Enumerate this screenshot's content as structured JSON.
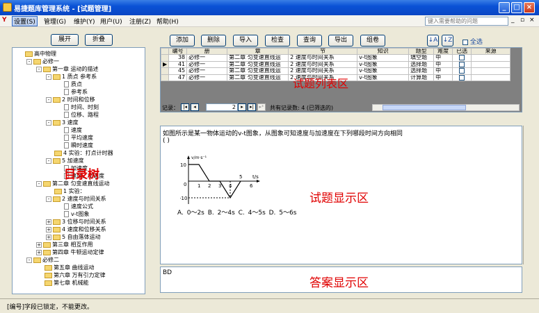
{
  "window": {
    "title": "易捷题库管理系统 - [试题管理]"
  },
  "menu": {
    "items": [
      "设置(S)",
      "管理(G)",
      "维护(Y)",
      "用户(U)",
      "注册(Z)",
      "帮助(H)"
    ],
    "help_placeholder": "键入需要帮助的问题"
  },
  "left": {
    "expand_label": "展开",
    "collapse_label": "折叠",
    "overlay": "目录树",
    "tree": [
      {
        "label": "高中物理",
        "level": 0,
        "kind": "folder"
      },
      {
        "label": "必修一",
        "level": 1,
        "kind": "folder",
        "toggle": "-"
      },
      {
        "label": "第一章 运动的描述",
        "level": 2,
        "kind": "folder",
        "toggle": "-"
      },
      {
        "label": "1 质点 参考系",
        "level": 3,
        "kind": "folder",
        "toggle": "-"
      },
      {
        "label": "质点",
        "level": 4,
        "kind": "doc"
      },
      {
        "label": "参考系",
        "level": 4,
        "kind": "doc"
      },
      {
        "label": "2 时间和位移",
        "level": 3,
        "kind": "folder",
        "toggle": "-"
      },
      {
        "label": "时间、时刻",
        "level": 4,
        "kind": "doc"
      },
      {
        "label": "位移、路程",
        "level": 4,
        "kind": "doc"
      },
      {
        "label": "3 速度",
        "level": 3,
        "kind": "folder",
        "toggle": "-"
      },
      {
        "label": "速度",
        "level": 4,
        "kind": "doc"
      },
      {
        "label": "平均速度",
        "level": 4,
        "kind": "doc"
      },
      {
        "label": "瞬时速度",
        "level": 4,
        "kind": "doc"
      },
      {
        "label": "4 实验：打点计时器",
        "level": 3,
        "kind": "folder"
      },
      {
        "label": "5 加速度",
        "level": 3,
        "kind": "folder",
        "toggle": "-"
      },
      {
        "label": "加速度",
        "level": 4,
        "kind": "doc"
      },
      {
        "label": "速度、加速度",
        "level": 4,
        "kind": "doc"
      },
      {
        "label": "第二章 匀变速直线运动",
        "level": 2,
        "kind": "folder",
        "toggle": "-"
      },
      {
        "label": "1 实验：",
        "level": 3,
        "kind": "folder"
      },
      {
        "label": "2 速度与时间关系",
        "level": 3,
        "kind": "folder",
        "toggle": "-"
      },
      {
        "label": "速度公式",
        "level": 4,
        "kind": "doc"
      },
      {
        "label": "v-t图象",
        "level": 4,
        "kind": "doc"
      },
      {
        "label": "3 位移与时间关系",
        "level": 3,
        "kind": "folder",
        "toggle": "+"
      },
      {
        "label": "4 速度和位移关系",
        "level": 3,
        "kind": "folder",
        "toggle": "+"
      },
      {
        "label": "5 自由落体运动",
        "level": 3,
        "kind": "folder",
        "toggle": "+"
      },
      {
        "label": "第三章 相互作用",
        "level": 2,
        "kind": "folder",
        "toggle": "+"
      },
      {
        "label": "第四章 牛顿运动定律",
        "level": 2,
        "kind": "folder",
        "toggle": "+"
      },
      {
        "label": "必修二",
        "level": 1,
        "kind": "folder",
        "toggle": "-"
      },
      {
        "label": "第五章 曲线运动",
        "level": 2,
        "kind": "folder"
      },
      {
        "label": "第六章 万有引力定律",
        "level": 2,
        "kind": "folder"
      },
      {
        "label": "第七章 机械能",
        "level": 2,
        "kind": "folder"
      }
    ]
  },
  "toolbar": {
    "add": "添加",
    "delete": "删除",
    "import": "导入",
    "check": "检查",
    "query": "查询",
    "export": "导出",
    "compose": "组卷",
    "select_all": "全选"
  },
  "grid": {
    "overlay": "试题列表区",
    "columns": [
      "编号",
      "册",
      "章",
      "节",
      "知识",
      "题型",
      "难度",
      "已选",
      "来源"
    ],
    "rows": [
      {
        "id": "38",
        "book": "必修一",
        "chapter": "第二章 匀变速直线运",
        "section": "2 速度与时间关系",
        "knowledge": "v-t图象",
        "type": "填空题",
        "difficulty": "中",
        "current": false
      },
      {
        "id": "41",
        "book": "必修一",
        "chapter": "第二章 匀变速直线运",
        "section": "2 速度与时间关系",
        "knowledge": "v-t图象",
        "type": "选择题",
        "difficulty": "中",
        "current": true
      },
      {
        "id": "45",
        "book": "必修一",
        "chapter": "第二章 匀变速直线运",
        "section": "2 速度与时间关系",
        "knowledge": "v-t图象",
        "type": "选择题",
        "difficulty": "中",
        "current": false
      },
      {
        "id": "47",
        "book": "必修一",
        "chapter": "第二章 匀变速直线运",
        "section": "2 速度与时间关系",
        "knowledge": "v-t图象",
        "type": "计算题",
        "difficulty": "中",
        "current": false
      }
    ],
    "nav_label": "记录：",
    "page_value": "2",
    "record_count": "共有记录数: 4 (已筛选的)"
  },
  "question": {
    "overlay": "试题显示区",
    "text": "如图所示是某一物体运动的v-t图象，从图象可知速度与加速度在下列哪段时间方向相同",
    "blank": "(      )",
    "graph_v_label": "v/m·s⁻¹",
    "graph_t_label": "t/s",
    "graph_y_pos": "10",
    "graph_y_neg": "-10",
    "graph_origin": "0",
    "graph_ticks": [
      "1",
      "2",
      "3",
      "4",
      "5",
      "6"
    ],
    "options": "A. 0～2s    B. 2～4s    C. 4～5s    D. 5～6s"
  },
  "answer": {
    "overlay": "答案显示区",
    "text": "BD"
  },
  "status": {
    "text": "[编号]字段已锁定，不能更改。"
  }
}
